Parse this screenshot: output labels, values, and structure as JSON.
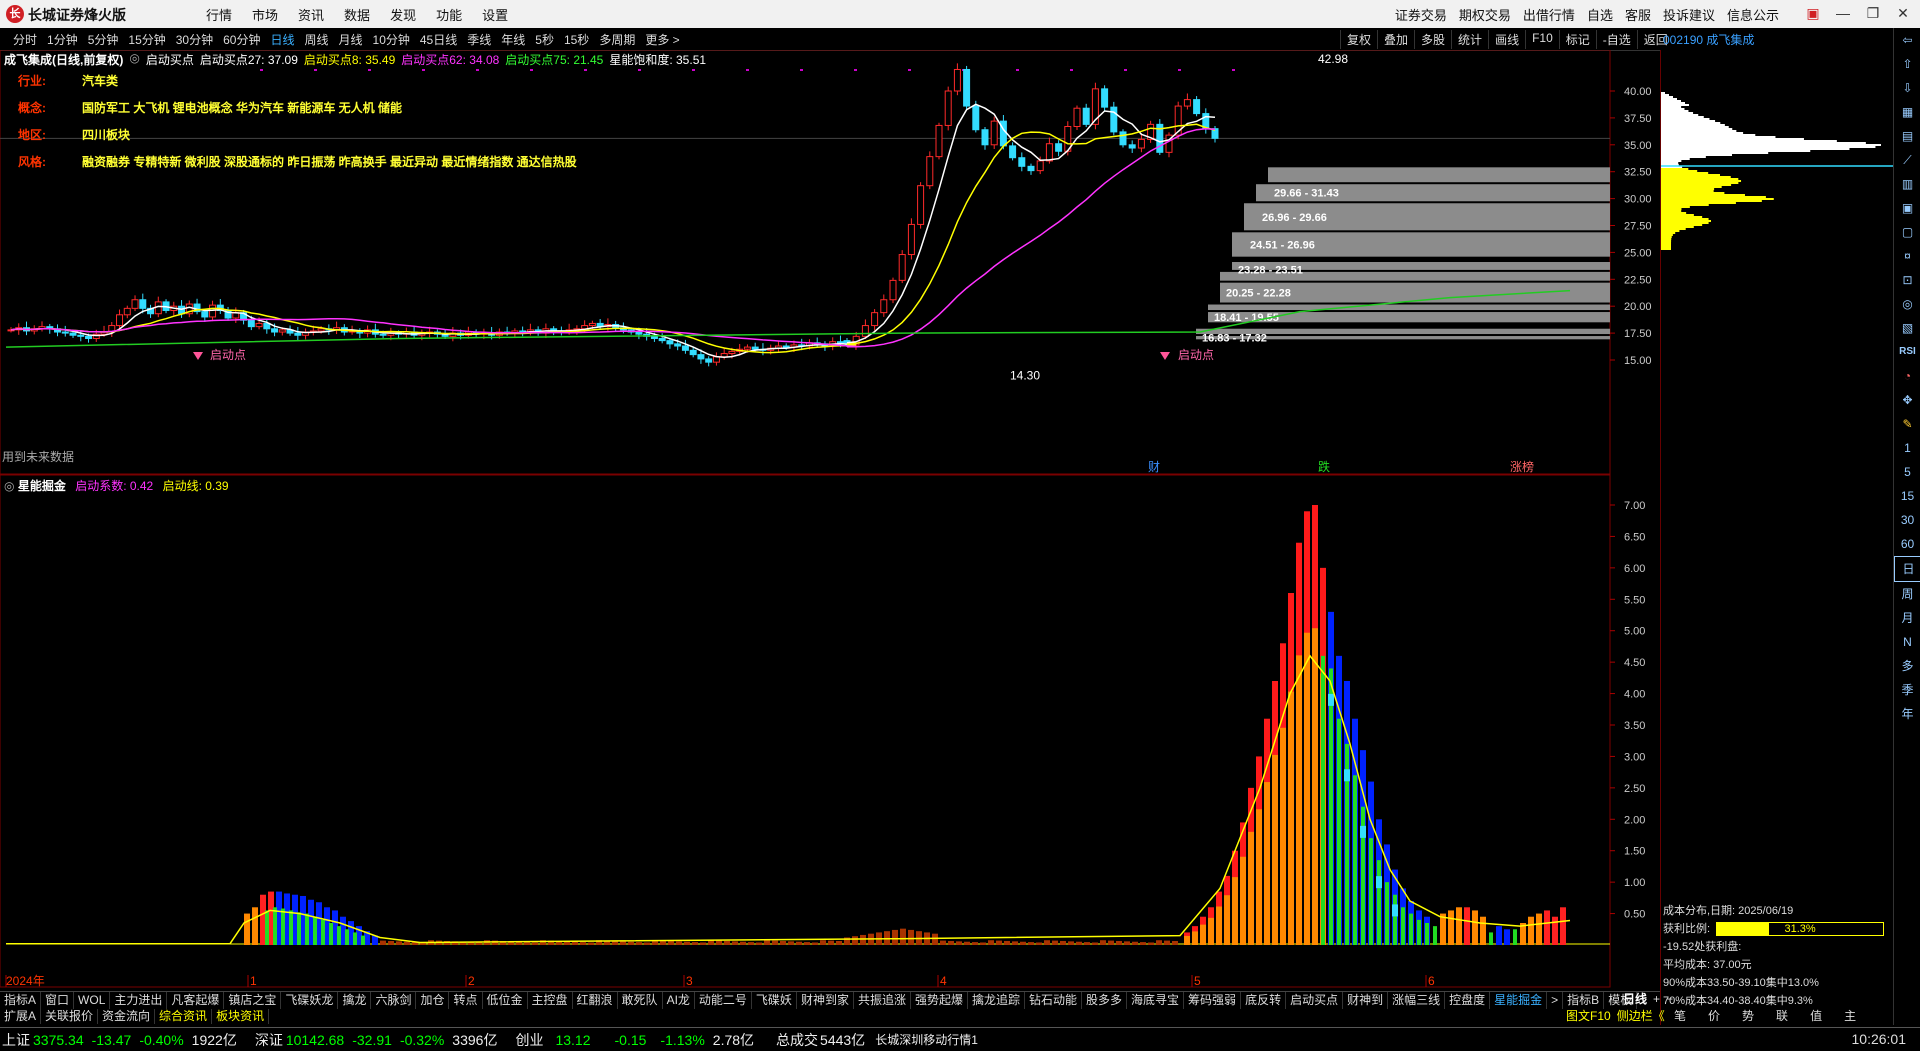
{
  "titlebar": {
    "logo": "长",
    "app_name": "长城证券烽火版",
    "menu": [
      "行情",
      "市场",
      "资讯",
      "数据",
      "发现",
      "功能",
      "设置"
    ],
    "right_menu": [
      "证券交易",
      "期权交易",
      "出借行情",
      "自选",
      "客服",
      "投诉建议",
      "信息公示"
    ]
  },
  "periodbar": {
    "periods": [
      "分时",
      "1分钟",
      "5分钟",
      "15分钟",
      "30分钟",
      "60分钟",
      "日线",
      "周线",
      "月线",
      "10分钟",
      "45日线",
      "季线",
      "年线",
      "5秒",
      "15秒",
      "多周期",
      "更多 >"
    ],
    "active_period": "日线",
    "tools": [
      "复权",
      "叠加",
      "多股",
      "统计",
      "画线",
      "F10",
      "标记",
      "-自选",
      "返回"
    ],
    "stock_code_name": "002190 成飞集成"
  },
  "main_chart": {
    "title": "成飞集成(日线,前复权)",
    "indicator_name": "启动买点",
    "values": [
      {
        "text": "启动买点27: 37.09",
        "color": "#ffffff"
      },
      {
        "text": "启动买点8: 35.49",
        "color": "#ffff00"
      },
      {
        "text": "启动买点62: 34.08",
        "color": "#ff33ff"
      },
      {
        "text": "启动买点75: 21.45",
        "color": "#33ff33"
      },
      {
        "text": "星能饱和度: 35.51",
        "color": "#ffffff"
      }
    ],
    "info_rows": [
      {
        "label": "行业:",
        "value": "汽车类"
      },
      {
        "label": "概念:",
        "value": "国防军工 大飞机 锂电池概念 华为汽车 新能源车 无人机 储能"
      },
      {
        "label": "地区:",
        "value": "四川板块"
      },
      {
        "label": "风格:",
        "value": "融资融券 专精特新 微利股 深股通标的 昨日振荡 昨高换手 最近异动 最近情绪指数 通达信热股"
      }
    ],
    "future_data_note": "用到未来数据",
    "high_label": "42.98",
    "low_label": "14.30",
    "marker_labels": [
      "启动点",
      "启动点"
    ],
    "event_labels": [
      "财",
      "跌",
      "涨榜"
    ],
    "zones": [
      "29.66 - 31.43",
      "26.96 - 29.66",
      "24.51 - 26.96",
      "23.28 - 23.51",
      "20.25 - 22.28",
      "18.41 - 19.55",
      "16.83 - 17.32"
    ],
    "price_axis": [
      "40.00",
      "37.50",
      "35.00",
      "32.50",
      "30.00",
      "27.50",
      "25.00",
      "22.50",
      "20.00",
      "17.50",
      "15.00"
    ]
  },
  "sub_chart": {
    "title": "星能掘金",
    "values": [
      {
        "text": "启动系数: 0.42",
        "color": "#ff33ff"
      },
      {
        "text": "启动线: 0.39",
        "color": "#ffff00"
      }
    ],
    "axis": [
      "7.00",
      "6.50",
      "6.00",
      "5.50",
      "5.00",
      "4.50",
      "4.00",
      "3.50",
      "3.00",
      "2.50",
      "2.00",
      "1.50",
      "1.00",
      "0.50"
    ],
    "x_labels": [
      "2024年",
      "1",
      "2",
      "3",
      "4",
      "5",
      "6"
    ]
  },
  "cost_distribution": {
    "title": "成本分布,日期: 2025/06/19",
    "profit_ratio_label": "获利比例:",
    "profit_ratio": "31.3%",
    "profit_fraction": 0.313,
    "line2": "-19.52处获利盘:",
    "avg_cost": "平均成本: 37.00元",
    "c90": "90%成本33.50-39.10集中13.0%",
    "c70": "70%成本34.40-38.40集中9.3%"
  },
  "bottom_tabs_row1": [
    "指标A",
    "窗口",
    "WOL",
    "主力进出",
    "凡客起爆",
    "镇店之宝",
    "飞碟妖龙",
    "擒龙",
    "六脉剑",
    "加仓",
    "转点",
    "低位金",
    "主控盘",
    "红翻浪",
    "敢死队",
    "AI龙",
    "动能二号",
    "飞碟妖",
    "财神到家",
    "共振追涨",
    "强势起爆",
    "擒龙追踪",
    "钻石动能",
    "股多多",
    "海底寻宝",
    "筹码强弱",
    "底反转",
    "启动买点",
    "财神到",
    "涨幅三线",
    "控盘度",
    "星能掘金",
    ">",
    "指标B",
    "模板"
  ],
  "bottom_tabs_active": "星能掘金",
  "bottom_tabs_row2": [
    "扩展A",
    "关联报价",
    "资金流向",
    "综合资讯",
    "板块资讯"
  ],
  "bottom_right_tabs": [
    "日线"
  ],
  "bottom_right_tabs2": [
    "图文F10",
    "侧边栏《"
  ],
  "bottom_right_tabs3": [
    "笔",
    "价",
    "势",
    "联",
    "值",
    "主"
  ],
  "status_bar": {
    "sh_name": "上证",
    "sh_index": "3375.34",
    "sh_change": "-13.47",
    "sh_pct": "-0.40%",
    "sh_amount": "1922亿",
    "sz_name": "深证",
    "sz_index": "10142.68",
    "sz_change": "-32.91",
    "sz_pct": "-0.32%",
    "sz_amount": "3396亿",
    "cy_name": "创业",
    "cy_index": "13.12",
    "cy_change": "-0.15",
    "cy_pct": "-1.13%",
    "cy_amount": "2.78亿",
    "total_label": "总成交",
    "total_amount": "5443亿",
    "feed_name": "长城深圳移动行情1",
    "time": "10:26:01"
  },
  "right_toolbar": [
    "1",
    "5",
    "15",
    "30",
    "60",
    "日",
    "周",
    "月",
    "N",
    "多",
    "季",
    "年"
  ],
  "right_tool_icons": [
    "RSI"
  ]
}
